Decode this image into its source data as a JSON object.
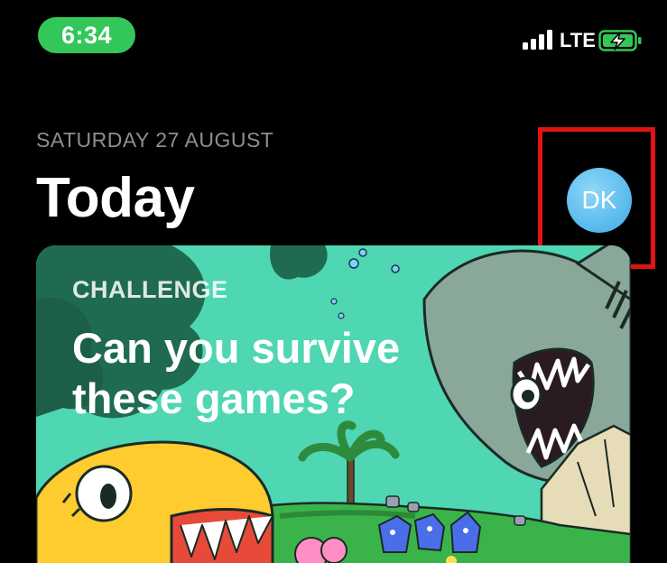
{
  "status_bar": {
    "time": "6:34",
    "network": "LTE",
    "icons": [
      "signal-icon",
      "battery-charging-icon"
    ],
    "time_pill_color": "#33c759"
  },
  "header": {
    "date": "SATURDAY 27 AUGUST",
    "title": "Today",
    "avatar_initials": "DK",
    "avatar_color": "#5ab9ec"
  },
  "highlight": {
    "color": "#e01414"
  },
  "featured_card": {
    "kicker": "CHALLENGE",
    "headline": "Can you survive these games?",
    "background_color": "#4fd6b2"
  }
}
